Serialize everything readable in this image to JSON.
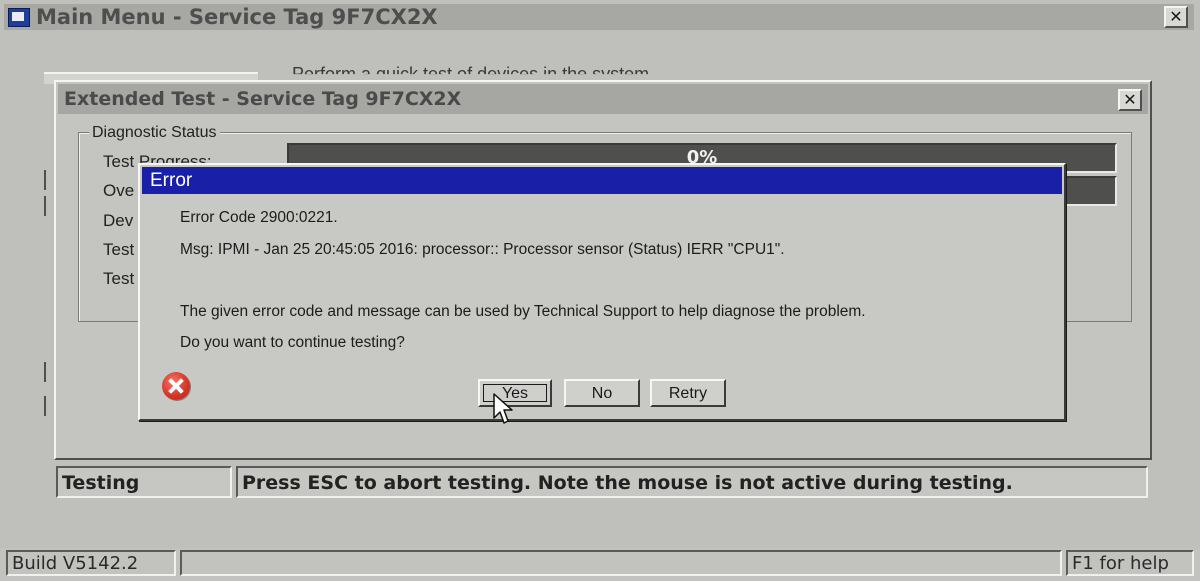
{
  "main_window": {
    "title": "Main Menu - Service Tag 9F7CX2X",
    "close_glyph": "✕",
    "background_text": "Perform a quick test of devices in the system"
  },
  "extended_test": {
    "title": "Extended Test - Service Tag 9F7CX2X",
    "close_glyph": "✕",
    "group_label": "Diagnostic Status",
    "rows": [
      {
        "label": "Test Progress:"
      },
      {
        "label": "Ove"
      },
      {
        "label": "Dev"
      },
      {
        "label": "Test"
      },
      {
        "label": "Test"
      }
    ],
    "progress": {
      "value": 0,
      "text": "0%"
    }
  },
  "error_dialog": {
    "title": "Error",
    "code_line": "Error Code  2900:0221.",
    "msg_line": "Msg: IPMI - Jan 25 20:45:05 2016: processor:: Processor sensor (Status) IERR \"CPU1\".",
    "info_line": "The given error code and message can be used by Technical Support to help diagnose the problem.",
    "question": "Do you want to continue testing?",
    "icon": "error-x-icon",
    "buttons": {
      "yes": "Yes",
      "no": "No",
      "retry": "Retry"
    }
  },
  "status_strip": {
    "state": "Testing",
    "message": "Press ESC to abort testing.  Note the mouse is not active during testing."
  },
  "bottom_bar": {
    "build": "Build  V5142.2",
    "middle": "",
    "help": "F1 for help"
  },
  "colors": {
    "dialog_title_bg": "#1a1fa8",
    "desktop_bg": "#bfbfbb",
    "progress_bar": "#4f4f4d"
  }
}
